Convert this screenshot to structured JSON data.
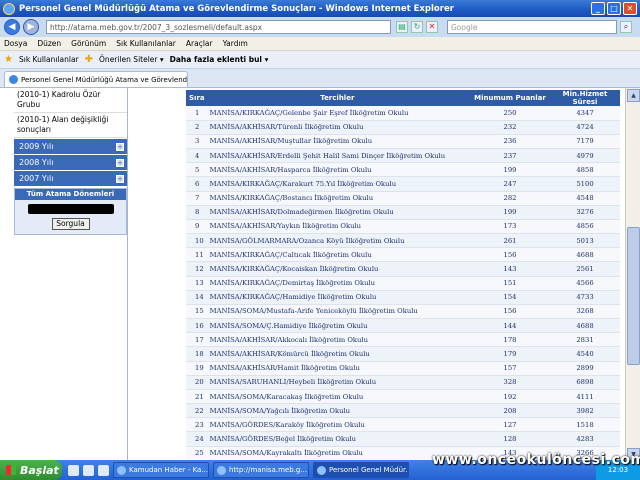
{
  "window": {
    "title": "Personel Genel Müdürlüğü Atama ve Görevlendirme Sonuçları - Windows Internet Explorer",
    "minimize": "_",
    "maximize": "□",
    "close": "✕"
  },
  "address_bar": {
    "url": "http://atama.meb.gov.tr/2007_3_sozlesmeli/default.aspx",
    "search_placeholder": "Google"
  },
  "menu": [
    "Dosya",
    "Düzen",
    "Görünüm",
    "Sık Kullanılanlar",
    "Araçlar",
    "Yardım"
  ],
  "favorites_bar": {
    "favorites": "Sık Kullanılanlar",
    "suggested": "Önerilen Siteler ▾",
    "addons": "Daha fazla eklenti bul ▾"
  },
  "tab": {
    "label": "Personel Genel Müdürlüğü Atama ve Görevlendirme S..."
  },
  "sidebar": {
    "links": [
      "(2010-1) Kadrolu Özür Grubu",
      "(2010-1) Alan değişikliği sonuçları"
    ],
    "years": [
      "2009 Yılı",
      "2008 Yılı",
      "2007 Yılı"
    ],
    "box_title": "Tüm Atama Dönemleri",
    "query_button": "Sorgula"
  },
  "table": {
    "headers": {
      "sira": "Sıra",
      "tercihler": "Tercihler",
      "puan": "Minumum Puanlar",
      "hizmet": "Min.Hizmet Süresi"
    },
    "rows": [
      {
        "no": "1",
        "name": "MANİSA/KIRKAĞAÇ/Gelenbe Şair Eşref İlköğretim Okulu",
        "puan": "250",
        "hizmet": "4347"
      },
      {
        "no": "2",
        "name": "MANİSA/AKHİSAR/Türenli İlköğretim Okulu",
        "puan": "232",
        "hizmet": "4724"
      },
      {
        "no": "3",
        "name": "MANİSA/AKHİSAR/Muştullar İlköğretim Okulu",
        "puan": "236",
        "hizmet": "7179"
      },
      {
        "no": "4",
        "name": "MANİSA/AKHİSAR/Erdelli Şehit Halil Sami Dinçer İlköğretim Okulu",
        "puan": "237",
        "hizmet": "4979"
      },
      {
        "no": "5",
        "name": "MANİSA/AKHİSAR/Hasparca İlköğretim Okulu",
        "puan": "199",
        "hizmet": "4858"
      },
      {
        "no": "6",
        "name": "MANİSA/KIRKAĞAÇ/Karakurt 75.Yıl İlköğretim Okulu",
        "puan": "247",
        "hizmet": "5100"
      },
      {
        "no": "7",
        "name": "MANİSA/KIRKAĞAÇ/Bostancı İlköğretim Okulu",
        "puan": "282",
        "hizmet": "4548"
      },
      {
        "no": "8",
        "name": "MANİSA/AKHİSAR/Dolmadeğirmen İlköğretim Okulu",
        "puan": "199",
        "hizmet": "3276"
      },
      {
        "no": "9",
        "name": "MANİSA/AKHİSAR/Yaykın İlköğretim Okulu",
        "puan": "173",
        "hizmet": "4856"
      },
      {
        "no": "10",
        "name": "MANİSA/GÖLMARMARA/Ozanca Köyü İlköğretim Okulu",
        "puan": "261",
        "hizmet": "5013"
      },
      {
        "no": "11",
        "name": "MANİSA/KIRKAĞAÇ/Caltıcak İlköğretim Okulu",
        "puan": "156",
        "hizmet": "4688"
      },
      {
        "no": "12",
        "name": "MANİSA/KIRKAĞAÇ/Kocaiskan İlköğretim Okulu",
        "puan": "143",
        "hizmet": "2561"
      },
      {
        "no": "13",
        "name": "MANİSA/KIRKAĞAÇ/Demirtaş İlköğretim Okulu",
        "puan": "151",
        "hizmet": "4566"
      },
      {
        "no": "14",
        "name": "MANİSA/KIRKAĞAÇ/Hamidiye İlköğretim Okulu",
        "puan": "154",
        "hizmet": "4733"
      },
      {
        "no": "15",
        "name": "MANİSA/SOMA/Mustafa-Arife Yeniceköylü İlköğretim Okulu",
        "puan": "156",
        "hizmet": "3268"
      },
      {
        "no": "16",
        "name": "MANİSA/SOMA/Ç.Hamidiye İlköğretim Okulu",
        "puan": "144",
        "hizmet": "4688"
      },
      {
        "no": "17",
        "name": "MANİSA/AKHİSAR/Akkocalı İlköğretim Okulu",
        "puan": "178",
        "hizmet": "2831"
      },
      {
        "no": "18",
        "name": "MANİSA/AKHİSAR/Kömürcü İlköğretim Okulu",
        "puan": "179",
        "hizmet": "4540"
      },
      {
        "no": "19",
        "name": "MANİSA/AKHİSAR/Hamit İlköğretim Okulu",
        "puan": "157",
        "hizmet": "2899"
      },
      {
        "no": "20",
        "name": "MANİSA/SARUHANLI/Heybeli İlköğretim Okulu",
        "puan": "328",
        "hizmet": "6898"
      },
      {
        "no": "21",
        "name": "MANİSA/SOMA/Karacakaş İlköğretim Okulu",
        "puan": "192",
        "hizmet": "4111"
      },
      {
        "no": "22",
        "name": "MANİSA/SOMA/Yağcılı İlköğretim Okulu",
        "puan": "208",
        "hizmet": "3982"
      },
      {
        "no": "23",
        "name": "MANİSA/GÖRDES/Karaköy İlköğretim Okulu",
        "puan": "127",
        "hizmet": "1518"
      },
      {
        "no": "24",
        "name": "MANİSA/GÖRDES/Beğel İlköğretim Okulu",
        "puan": "128",
        "hizmet": "4283"
      },
      {
        "no": "25",
        "name": "MANİSA/SOMA/Kayrakaltı İlköğretim Okulu",
        "puan": "143",
        "hizmet": "3266"
      }
    ]
  },
  "scrollbar": {
    "position": 0.6,
    "visible_fraction": 0.4
  },
  "taskbar": {
    "start": "Başlat",
    "tasks": [
      "Kamudan Haber - Ka...",
      "http://manisa.meb.g...",
      "Personel Genel Müdür..."
    ],
    "tray": "12:03"
  },
  "watermark": "www.onceokulöncesi.com"
}
